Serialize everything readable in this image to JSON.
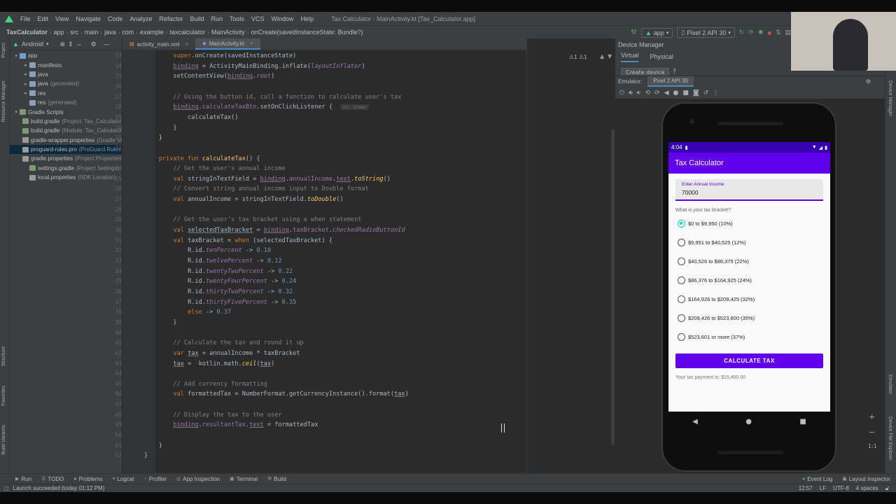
{
  "menu": {
    "items": [
      "File",
      "Edit",
      "View",
      "Navigate",
      "Code",
      "Analyze",
      "Refactor",
      "Build",
      "Run",
      "Tools",
      "VCS",
      "Window",
      "Help"
    ],
    "window_title": "Tax Calculator - MainActivity.kt [Tax_Calculator.app]"
  },
  "nav": {
    "crumbs": [
      "TaxCalculator",
      "app",
      "src",
      "main",
      "java",
      "com",
      "example",
      "taxcalculator",
      "MainActivity",
      "onCreate(savedInstanceState: Bundle?)"
    ],
    "run_config": "app",
    "device": "Pixel 2 API 30"
  },
  "project": {
    "view_label": "Android",
    "tree": [
      {
        "label": "app",
        "hint": "",
        "arrow": "▾",
        "indent": 0,
        "color": "#6e9fd2"
      },
      {
        "label": "manifests",
        "hint": "",
        "arrow": "▸",
        "indent": 1,
        "color": "#8aa0b8"
      },
      {
        "label": "java",
        "hint": "",
        "arrow": "▸",
        "indent": 1,
        "color": "#8aa0b8"
      },
      {
        "label": "java",
        "hint": "(generated)",
        "arrow": "▸",
        "indent": 1,
        "color": "#8aa0b8"
      },
      {
        "label": "res",
        "hint": "",
        "arrow": "▸",
        "indent": 1,
        "color": "#8aa0b8"
      },
      {
        "label": "res",
        "hint": "(generated)",
        "arrow": "",
        "indent": 1,
        "color": "#8aa0b8"
      },
      {
        "label": "Gradle Scripts",
        "hint": "",
        "arrow": "▾",
        "indent": 0,
        "color": "#7a9a7a"
      },
      {
        "label": "build.gradle",
        "hint": "(Project: Tax_Calculator)",
        "arrow": "",
        "indent": 1,
        "color": "#7a9a7a"
      },
      {
        "label": "build.gradle",
        "hint": "(Module: Tax_Calculator.app)",
        "arrow": "",
        "indent": 1,
        "color": "#7a9a7a"
      },
      {
        "label": "gradle-wrapper.properties",
        "hint": "(Gradle Version)",
        "arrow": "",
        "indent": 1,
        "color": "#9a9a9a"
      },
      {
        "label": "proguard-rules.pro",
        "hint": "(ProGuard Rules for Tax_Calculator.app)",
        "arrow": "",
        "indent": 1,
        "color": "#9a9a9a",
        "selected": true
      },
      {
        "label": "gradle.properties",
        "hint": "(Project Properties)",
        "arrow": "",
        "indent": 1,
        "color": "#9a9a9a"
      },
      {
        "label": "settings.gradle",
        "hint": "(Project Settings)",
        "arrow": "",
        "indent": 1,
        "color": "#7a9a7a"
      },
      {
        "label": "local.properties",
        "hint": "(SDK Location)",
        "arrow": "",
        "indent": 1,
        "color": "#9a9a9a"
      }
    ]
  },
  "left_strip": [
    "Project",
    "Resource Manager",
    "Structure",
    "Favorites",
    "Build Variants"
  ],
  "editor": {
    "tabs": [
      {
        "label": "activity_main.xml",
        "active": false
      },
      {
        "label": "MainActivity.kt",
        "active": true
      }
    ],
    "inspection": "⚠1  ⚠1",
    "lines": [
      {
        "n": "13",
        "html": "        <span class=\"kw\">super</span>.onCreate(savedInstanceState)"
      },
      {
        "n": "14",
        "html": "        <span class=\"prop ul\">binding</span> = ActivityMainBinding.inflate(<span class=\"prop ital\">layoutInflater</span>)"
      },
      {
        "n": "15",
        "html": "        setContentView(<span class=\"prop ul\">binding</span>.<span class=\"prop ital\">root</span>)"
      },
      {
        "n": "16",
        "html": ""
      },
      {
        "n": "17",
        "html": "        <span class=\"cm\">// Using the button id, call a function to calculate user's tax</span>"
      },
      {
        "n": "18",
        "html": "        <span class=\"prop ul\">binding</span>.<span class=\"prop\">calculateTaxBtn</span>.setOnClickListener { <span class=\"hintbox\">it: View!</span>"
      },
      {
        "n": "19",
        "html": "            calculateTax()"
      },
      {
        "n": "20",
        "html": "        }"
      },
      {
        "n": "21",
        "html": "    <span class=\"fn\">}</span>"
      },
      {
        "n": "22",
        "html": ""
      },
      {
        "n": "23",
        "html": "    <span class=\"kw\">private fun</span> <span class=\"fn\">calculateTax</span>() {"
      },
      {
        "n": "24",
        "html": "        <span class=\"cm\">// Get the user's annual income</span>"
      },
      {
        "n": "25",
        "html": "        <span class=\"kw\">val</span> stringInTextField = <span class=\"prop ul\">binding</span>.<span class=\"prop\">annualIncome</span>.<span class=\"prop ul\">text</span>.<span class=\"fn ital\">toString</span>()"
      },
      {
        "n": "26",
        "html": "        <span class=\"cm\">// Convert string annual income input to Double format</span>"
      },
      {
        "n": "27",
        "html": "        <span class=\"kw\">val</span> annualIncome = stringInTextField.<span class=\"fn ital\">toDouble</span>()"
      },
      {
        "n": "28",
        "html": ""
      },
      {
        "n": "29",
        "html": "        <span class=\"cm\">// Get the user's tax bracket using a when statement</span>"
      },
      {
        "n": "30",
        "html": "        <span class=\"kw\">val</span> <span class=\"ul\">selectedTaxBracket</span> = <span class=\"prop ul\">binding</span>.<span class=\"prop\">taxBracket</span>.<span class=\"prop ital\">checkedRadioButtonId</span>"
      },
      {
        "n": "31",
        "html": "        <span class=\"kw\">val</span> taxBracket = <span class=\"kw\">when</span> (selectedTaxBracket) {"
      },
      {
        "n": "32",
        "html": "            R.id.<span class=\"prop ital\">tenPercent</span> -&gt; <span class=\"num\">0.10</span>"
      },
      {
        "n": "33",
        "html": "            R.id.<span class=\"prop ital\">twelvePercent</span> -&gt; <span class=\"num\">0.12</span>"
      },
      {
        "n": "34",
        "html": "            R.id.<span class=\"prop ital\">twentyTwoPercent</span> -&gt; <span class=\"num\">0.22</span>"
      },
      {
        "n": "35",
        "html": "            R.id.<span class=\"prop ital\">twentyFourPercent</span> -&gt; <span class=\"num\">0.24</span>"
      },
      {
        "n": "36",
        "html": "            R.id.<span class=\"prop ital\">thirtyTwoPercent</span> -&gt; <span class=\"num\">0.32</span>"
      },
      {
        "n": "37",
        "html": "            R.id.<span class=\"prop ital\">thirtyFivePercent</span> -&gt; <span class=\"num\">0.35</span>"
      },
      {
        "n": "38",
        "html": "            <span class=\"kw\">else</span> -&gt; <span class=\"num\">0.37</span>"
      },
      {
        "n": "39",
        "html": "        }"
      },
      {
        "n": "40",
        "html": ""
      },
      {
        "n": "41",
        "html": "        <span class=\"cm\">// Calculate the tax and round it up</span>"
      },
      {
        "n": "42",
        "html": "        <span class=\"kw\">var</span> <span class=\"ul\">tax</span> = annualIncome * taxBracket"
      },
      {
        "n": "43",
        "html": "        <span class=\"ul\">tax</span> =  kotlin.math.<span class=\"fn ital\">ceil</span>(<span class=\"ul\">tax</span>)"
      },
      {
        "n": "44",
        "html": ""
      },
      {
        "n": "45",
        "html": "        <span class=\"cm\">// Add currency formatting</span>"
      },
      {
        "n": "46",
        "html": "        <span class=\"kw\">val</span> formattedTax = NumberFormat.getCurrencyInstance().format(<span class=\"ul\">tax</span>)"
      },
      {
        "n": "47",
        "html": ""
      },
      {
        "n": "48",
        "html": "        <span class=\"cm\">// Display the tax to the user</span>"
      },
      {
        "n": "49",
        "html": "        <span class=\"prop ul\">binding</span>.<span class=\"prop\">resultantTax</span>.<span class=\"prop ul\">text</span> = formattedTax"
      },
      {
        "n": "50",
        "html": ""
      },
      {
        "n": "51",
        "html": "    }"
      },
      {
        "n": "52",
        "html": "}"
      }
    ]
  },
  "device_manager": {
    "title": "Device Manager",
    "tabs": [
      "Virtual",
      "Physical"
    ],
    "create_device": "Create device",
    "help": "?",
    "emulator_label": "Emulator:",
    "emulator_tab": "Pixel 2 API 30"
  },
  "phone_app": {
    "time": "4:04",
    "title": "Tax Calculator",
    "income_label": "Enter Annual Income",
    "income_value": "70000",
    "bracket_question": "What is your tax bracket?",
    "brackets": [
      {
        "label": "$0 to $9,950 (10%)",
        "checked": true
      },
      {
        "label": "$9,951 to $40,525 (12%)",
        "checked": false
      },
      {
        "label": "$40,526 to $86,375 (22%)",
        "checked": false
      },
      {
        "label": "$86,376 to $164,925 (24%)",
        "checked": false
      },
      {
        "label": "$164,926 to $209,425 (32%)",
        "checked": false
      },
      {
        "label": "$209,426 to $523,600 (35%)",
        "checked": false
      },
      {
        "label": "$523,601 or more (37%)",
        "checked": false
      }
    ],
    "button": "CALCULATE TAX",
    "result": "Your tax payment is: $15,400.00"
  },
  "right_strip": [
    "Device Manager",
    "Emulator",
    "Device File Explorer"
  ],
  "bottom_tools": [
    {
      "label": "Run",
      "icon": "▶"
    },
    {
      "label": "TODO",
      "icon": "☰"
    },
    {
      "label": "Problems",
      "icon": "●"
    },
    {
      "label": "Logcat",
      "icon": "≡"
    },
    {
      "label": "Profiler",
      "icon": "◔"
    },
    {
      "label": "App Inspection",
      "icon": "◎"
    },
    {
      "label": "Terminal",
      "icon": "▣"
    },
    {
      "label": "Build",
      "icon": "⚒"
    }
  ],
  "bottom_right_tools": [
    "Event Log",
    "Layout Inspector"
  ],
  "status": {
    "message": "Launch succeeded (today 01:12 PM)",
    "position": "12:57",
    "line_sep": "LF",
    "encoding": "UTF-8",
    "indent": "4 spaces"
  },
  "colors": {
    "ide_bg": "#2b2b2b",
    "panel_bg": "#3c3f41",
    "app_primary": "#6200ee",
    "app_status": "#3700b3",
    "radio_checked": "#03dac5"
  }
}
